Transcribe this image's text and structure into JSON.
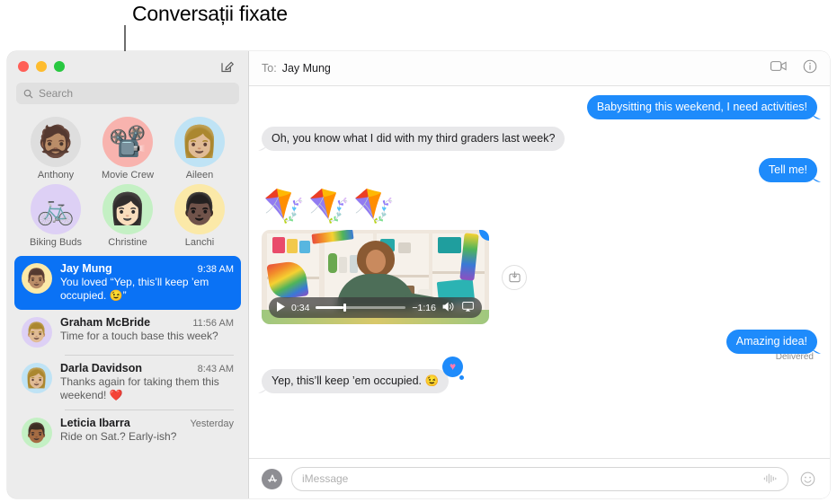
{
  "callout": {
    "label": "Conversații fixate"
  },
  "sidebar": {
    "compose_icon": "compose-icon",
    "search": {
      "placeholder": "Search",
      "icon": "search-icon"
    },
    "pinned": [
      {
        "name": "Anthony",
        "glyph": "🧔🏽",
        "bg": "#dedede"
      },
      {
        "name": "Movie Crew",
        "glyph": "📽️",
        "bg": "#f8b3ae"
      },
      {
        "name": "Aileen",
        "glyph": "👩🏼",
        "bg": "#bfe3f5"
      },
      {
        "name": "Biking Buds",
        "glyph": "🚲",
        "bg": "#ddd0f5"
      },
      {
        "name": "Christine",
        "glyph": "👩🏻",
        "bg": "#c4f0c4"
      },
      {
        "name": "Lanchi",
        "glyph": "👨🏿",
        "bg": "#fbe9a8"
      }
    ],
    "conversations": [
      {
        "name": "Jay Mung",
        "time": "9:38 AM",
        "preview": "You loved “Yep, this’ll keep ’em occupied. 😉”",
        "glyph": "👨🏽",
        "bg": "#fbe9a8",
        "selected": true
      },
      {
        "name": "Graham McBride",
        "time": "11:56 AM",
        "preview": "Time for a touch base this week?",
        "glyph": "👨🏼",
        "bg": "#ddd0f5",
        "selected": false
      },
      {
        "name": "Darla Davidson",
        "time": "8:43 AM",
        "preview": "Thanks again for taking them this weekend! ❤️",
        "glyph": "👩🏼",
        "bg": "#bfe3f5",
        "selected": false
      },
      {
        "name": "Leticia Ibarra",
        "time": "Yesterday",
        "preview": "Ride on Sat.? Early-ish?",
        "glyph": "👨🏾",
        "bg": "#c4f0c4",
        "selected": false
      }
    ]
  },
  "thread": {
    "to_label": "To:",
    "recipient": "Jay Mung",
    "facetime_icon": "video-camera-icon",
    "info_icon": "info-icon",
    "messages": {
      "m1": "Babysitting this weekend, I need activities!",
      "m2": "Oh, you know what I did with my third graders last week?",
      "m3": "Tell me!",
      "emoji_row": "🪁🪁🪁",
      "m4": "Amazing idea!",
      "m5": "Yep, this’ll keep ’em occupied. 😉"
    },
    "delivered_status": "Delivered",
    "reaction": "♥",
    "video": {
      "elapsed": "0:34",
      "remaining": "−1:16",
      "progress_percent": 31,
      "play_icon": "play-icon",
      "volume_icon": "volume-icon",
      "airplay_icon": "airplay-icon",
      "save_icon": "download-icon"
    }
  },
  "composer": {
    "apps_icon": "app-store-icon",
    "placeholder": "iMessage",
    "audio_icon": "audio-waveform-icon",
    "emoji_icon": "emoji-smiley-icon"
  },
  "colors": {
    "accent_blue": "#1e8bfb",
    "selected_blue": "#0a72f5",
    "bubble_gray": "#e8e8ea",
    "sidebar_bg": "#ececec"
  }
}
